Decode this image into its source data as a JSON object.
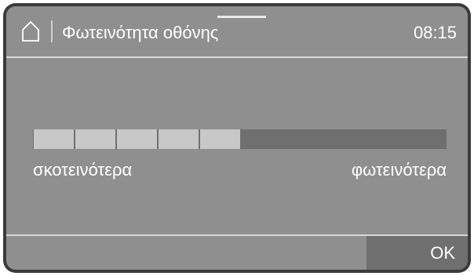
{
  "header": {
    "home_icon": "home-icon",
    "title": "Φωτεινότητα οθόνης",
    "time": "08:15"
  },
  "brightness": {
    "level": 5,
    "max_segments": 10,
    "label_low": "σκοτεινότερα",
    "label_high": "φωτεινότερα"
  },
  "footer": {
    "ok_label": "OK"
  },
  "colors": {
    "screen_background": "#8f8f8f",
    "bezel": "#3b3b3b",
    "segment_on": "#c8c8c8",
    "segment_off": "#6f6f6f",
    "text": "#ffffff"
  }
}
